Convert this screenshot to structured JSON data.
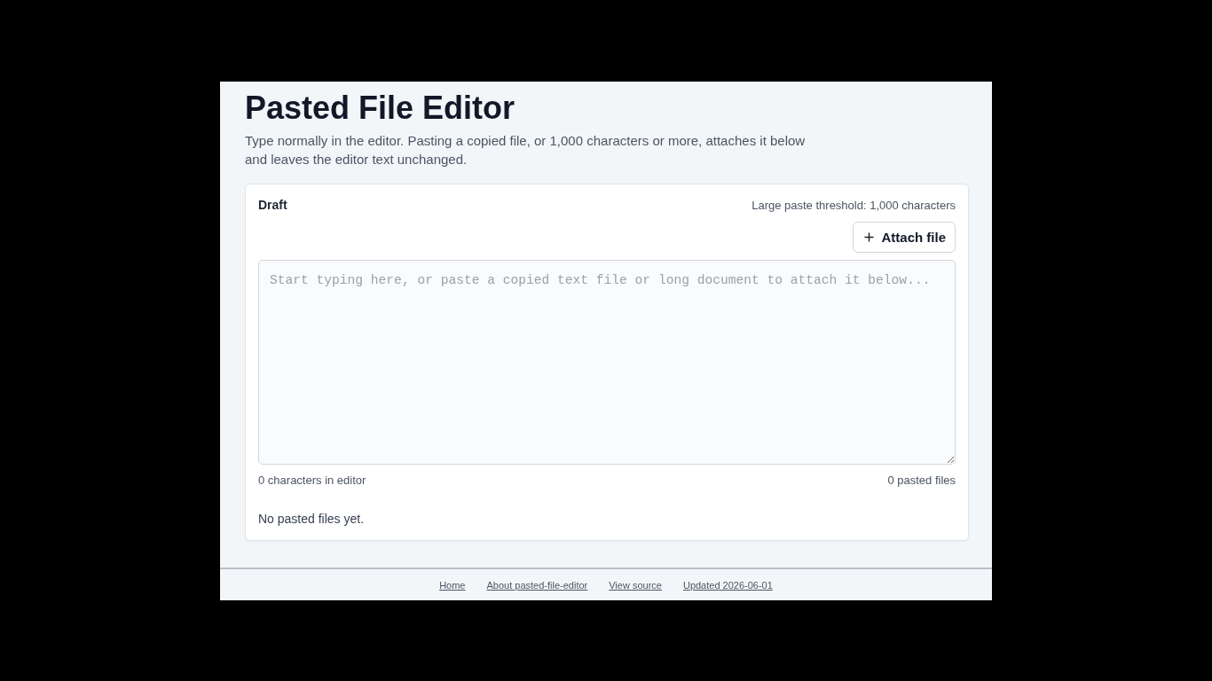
{
  "page": {
    "title": "Pasted File Editor",
    "description": "Type normally in the editor. Pasting a copied file, or 1,000 characters or more, attaches it below and leaves the editor text unchanged."
  },
  "draft": {
    "label": "Draft",
    "threshold": "Large paste threshold: 1,000 characters",
    "attach_button": {
      "label": "Attach file"
    },
    "editor": {
      "placeholder": "Start typing here, or paste a copied text file or long document to attach it below..."
    },
    "character_count": "0 characters in editor",
    "pasted_count": "0 pasted files",
    "empty_message": "No pasted files yet."
  },
  "footer": {
    "links": [
      "Home",
      "About pasted-file-editor",
      "View source",
      "Updated 2026-06-01"
    ]
  }
}
